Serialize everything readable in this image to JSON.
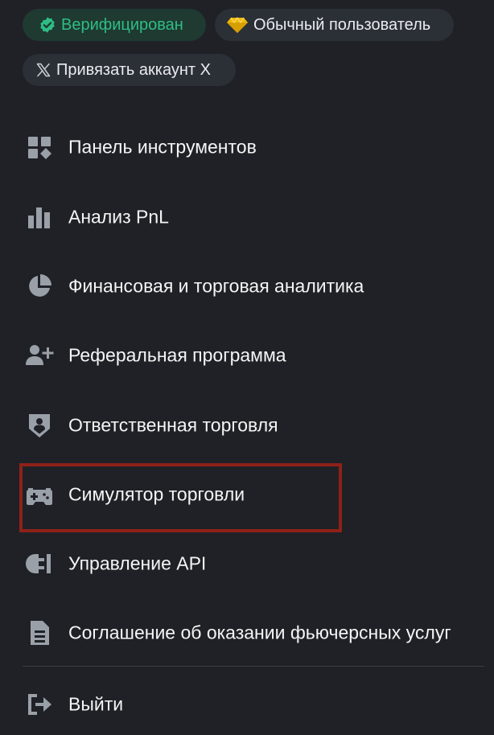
{
  "badges": {
    "verified": {
      "label": "Верифицирован",
      "icon": "verified-check-icon",
      "color": "#2ebd85"
    },
    "user_level": {
      "label": "Обычный пользователь",
      "icon": "diamond-icon",
      "color": "#f0b90b"
    },
    "link_x": {
      "label": "Привязать аккаунт X",
      "icon": "x-logo-icon"
    }
  },
  "menu": {
    "items": [
      {
        "label": "Панель инструментов",
        "icon": "dashboard-icon"
      },
      {
        "label": "Анализ PnL",
        "icon": "bar-chart-icon"
      },
      {
        "label": "Финансовая и торговая аналитика",
        "icon": "pie-chart-icon"
      },
      {
        "label": "Реферальная программа",
        "icon": "add-user-icon"
      },
      {
        "label": "Ответственная торговля",
        "icon": "shield-user-icon"
      },
      {
        "label": "Симулятор торговли",
        "icon": "gamepad-icon",
        "highlighted": true
      },
      {
        "label": "Управление API",
        "icon": "api-plug-icon"
      },
      {
        "label": "Соглашение об оказании фьючерсных услуг",
        "icon": "document-icon"
      }
    ],
    "logout": {
      "label": "Выйти",
      "icon": "logout-icon"
    }
  },
  "colors": {
    "background": "#1f2127",
    "icon_gray": "#9aa0a8",
    "highlight_border": "#8e2118"
  }
}
